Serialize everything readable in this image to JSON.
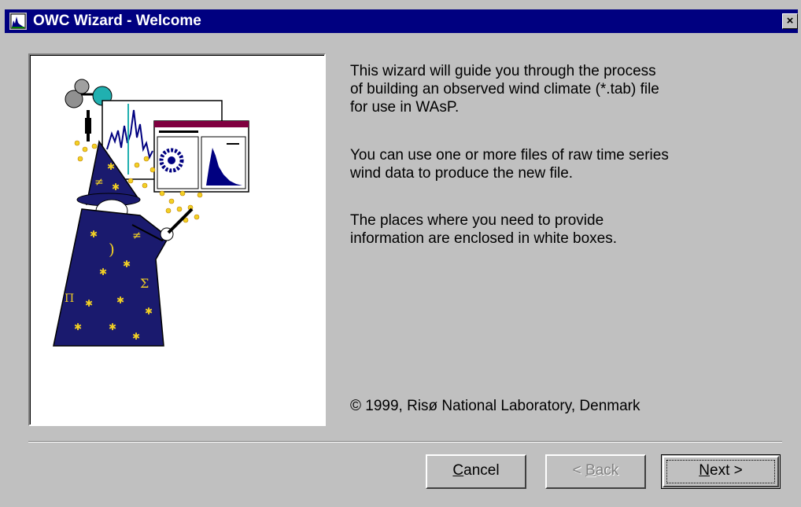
{
  "window": {
    "title": "OWC Wizard - Welcome",
    "close_glyph": "×",
    "app_icon": "chart-icon"
  },
  "content": {
    "para1_line1": "This wizard will guide you through the process",
    "para1_line2": "of building an observed wind climate (*.tab) file",
    "para1_line3": "for use in WAsP.",
    "para2_line1": "You can use one or more files of raw time series",
    "para2_line2": "wind data to produce the new file.",
    "para3_line1": "The places where you need to provide",
    "para3_line2": "information are enclosed in white boxes.",
    "copyright": "© 1999, Risø National Laboratory, Denmark"
  },
  "buttons": {
    "cancel_mnemonic": "C",
    "cancel_rest": "ancel",
    "back_prefix": "< ",
    "back_mnemonic": "B",
    "back_rest": "ack",
    "next_mnemonic": "N",
    "next_rest": "ext >"
  },
  "colors": {
    "titlebar": "#000080",
    "wizard_robe": "#1a1a6e",
    "stars": "#f2d024"
  }
}
